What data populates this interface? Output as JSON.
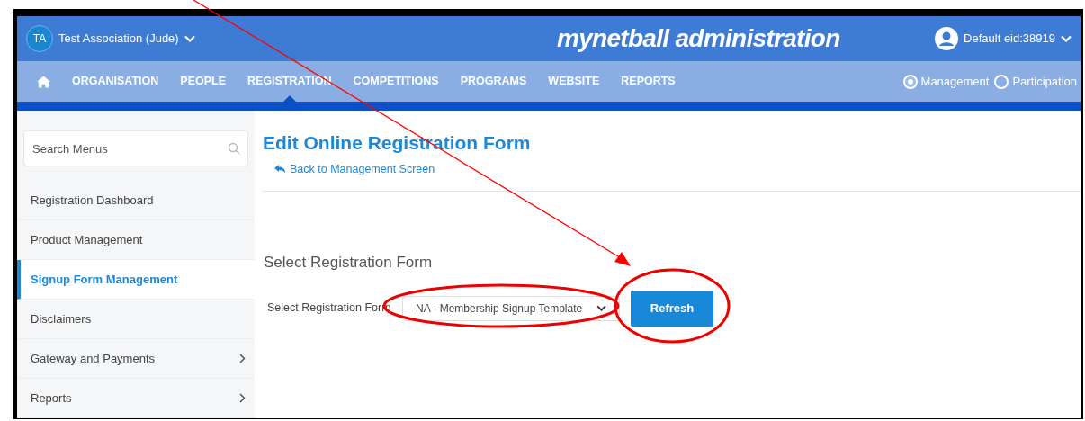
{
  "header": {
    "org_initials": "TA",
    "org_name": "Test Association (Jude)",
    "app_title": "mynetball administration",
    "user": "Default eid:38919"
  },
  "nav": {
    "items": [
      {
        "kind": "home",
        "selected": false
      },
      {
        "kind": "text",
        "label": "ORGANISATION",
        "selected": false
      },
      {
        "kind": "text",
        "label": "PEOPLE",
        "selected": false
      },
      {
        "kind": "text",
        "label": "REGISTRATION",
        "selected": true
      },
      {
        "kind": "text",
        "label": "COMPETITIONS",
        "selected": false
      },
      {
        "kind": "text",
        "label": "PROGRAMS",
        "selected": false
      },
      {
        "kind": "text",
        "label": "WEBSITE",
        "selected": false
      },
      {
        "kind": "text",
        "label": "REPORTS",
        "selected": false
      }
    ],
    "modes": [
      {
        "label": "Management",
        "selected": true
      },
      {
        "label": "Participation",
        "selected": false
      }
    ]
  },
  "sidebar": {
    "search": {
      "placeholder": "Search Menus"
    },
    "items": [
      {
        "label": "Registration Dashboard",
        "selected": false,
        "has_submenu": false
      },
      {
        "label": "Product Management",
        "selected": false,
        "has_submenu": false
      },
      {
        "label": "Signup Form Management",
        "selected": true,
        "has_submenu": false
      },
      {
        "label": "Disclaimers",
        "selected": false,
        "has_submenu": false
      },
      {
        "label": "Gateway and Payments",
        "selected": false,
        "has_submenu": true
      },
      {
        "label": "Reports",
        "selected": false,
        "has_submenu": true
      }
    ]
  },
  "main": {
    "title": "Edit Online Registration Form",
    "back_link": "Back to Management Screen",
    "section_title": "Select Registration Form",
    "field_label": "Select Registration Form",
    "select_value": "NA - Membership Signup Template",
    "button": "Refresh"
  }
}
